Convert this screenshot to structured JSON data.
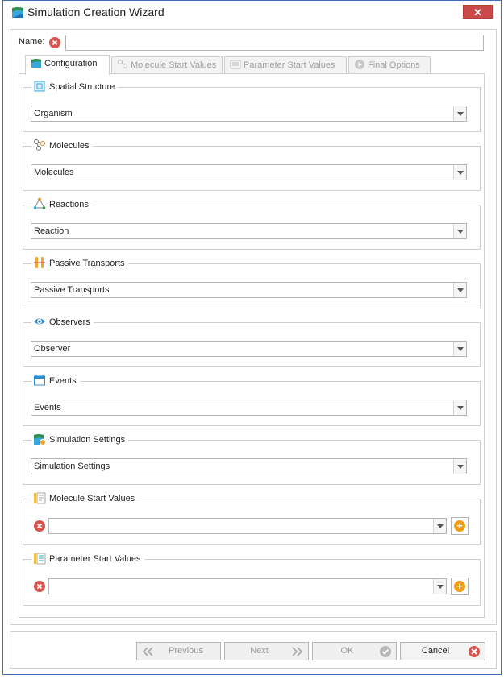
{
  "window": {
    "title": "Simulation Creation Wizard",
    "close_glyph": "✕"
  },
  "name_field": {
    "label": "Name:",
    "value": ""
  },
  "tabs": [
    {
      "label": "Configuration",
      "icon": "configuration-icon",
      "active": true
    },
    {
      "label": "Molecule Start Values",
      "icon": "molecule-start-values-icon",
      "active": false
    },
    {
      "label": "Parameter Start Values",
      "icon": "parameter-start-values-icon",
      "active": false
    },
    {
      "label": "Final Options",
      "icon": "final-options-icon",
      "active": false
    }
  ],
  "groups": {
    "spatial_structure": {
      "title": "Spatial Structure",
      "value": "Organism"
    },
    "molecules": {
      "title": "Molecules",
      "value": "Molecules"
    },
    "reactions": {
      "title": "Reactions",
      "value": "Reaction"
    },
    "passive_transports": {
      "title": "Passive Transports",
      "value": "Passive Transports"
    },
    "observers": {
      "title": "Observers",
      "value": "Observer"
    },
    "events": {
      "title": "Events",
      "value": "Events"
    },
    "simulation_settings": {
      "title": "Simulation Settings",
      "value": "Simulation Settings"
    },
    "molecule_start_values": {
      "title": "Molecule Start Values",
      "value": ""
    },
    "parameter_start_values": {
      "title": "Parameter Start Values",
      "value": ""
    }
  },
  "footer": {
    "previous": "Previous",
    "next": "Next",
    "ok": "OK",
    "cancel": "Cancel"
  },
  "colors": {
    "error": "#d9534f",
    "add": "#f39c12",
    "window_border": "#3c6fb4",
    "close_button": "#c94a4a"
  }
}
